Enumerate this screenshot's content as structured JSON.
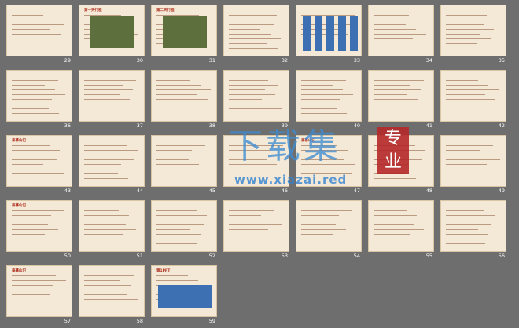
{
  "slides": [
    {
      "n": "29",
      "title": ""
    },
    {
      "n": "30",
      "title": "第一天行程"
    },
    {
      "n": "31",
      "title": "第二天行程"
    },
    {
      "n": "32",
      "title": ""
    },
    {
      "n": "33",
      "title": ""
    },
    {
      "n": "34",
      "title": ""
    },
    {
      "n": "35",
      "title": ""
    },
    {
      "n": "36",
      "title": ""
    },
    {
      "n": "37",
      "title": ""
    },
    {
      "n": "38",
      "title": ""
    },
    {
      "n": "39",
      "title": ""
    },
    {
      "n": "40",
      "title": ""
    },
    {
      "n": "41",
      "title": ""
    },
    {
      "n": "42",
      "title": ""
    },
    {
      "n": "43",
      "title": "泰慕山记"
    },
    {
      "n": "44",
      "title": ""
    },
    {
      "n": "45",
      "title": ""
    },
    {
      "n": "46",
      "title": ""
    },
    {
      "n": "47",
      "title": "泰慕山记"
    },
    {
      "n": "48",
      "title": ""
    },
    {
      "n": "49",
      "title": ""
    },
    {
      "n": "50",
      "title": "泰慕山记"
    },
    {
      "n": "51",
      "title": ""
    },
    {
      "n": "52",
      "title": ""
    },
    {
      "n": "53",
      "title": ""
    },
    {
      "n": "54",
      "title": ""
    },
    {
      "n": "55",
      "title": ""
    },
    {
      "n": "56",
      "title": ""
    },
    {
      "n": "57",
      "title": "泰慕山记"
    },
    {
      "n": "58",
      "title": ""
    },
    {
      "n": "59",
      "title": "第1PPT"
    }
  ],
  "watermark": {
    "cn": "下载集",
    "box": "专业",
    "url": "www.xiazai.red"
  }
}
